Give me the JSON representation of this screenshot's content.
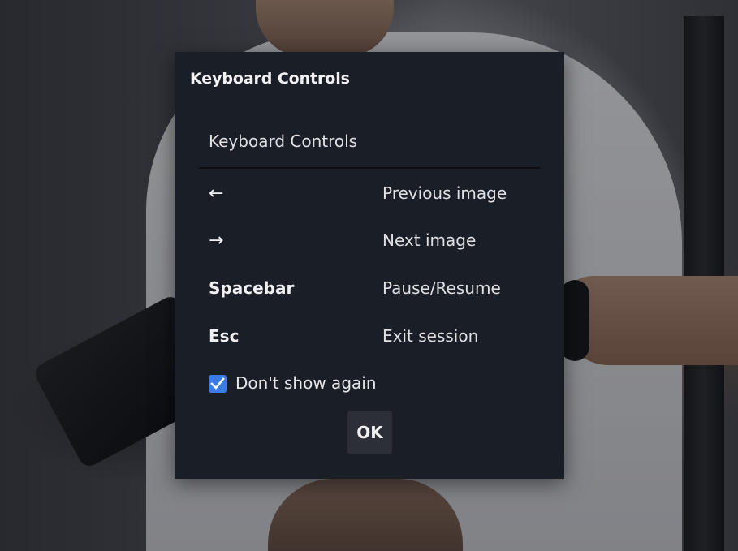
{
  "dialog": {
    "title": "Keyboard Controls",
    "section_header": "Keyboard Controls",
    "shortcuts": [
      {
        "key": "←",
        "action": "Previous image"
      },
      {
        "key": "→",
        "action": "Next image"
      },
      {
        "key": "Spacebar",
        "action": "Pause/Resume"
      },
      {
        "key": "Esc",
        "action": "Exit session"
      }
    ],
    "checkbox": {
      "label": "Don't show again",
      "checked": true
    },
    "ok_label": "OK"
  },
  "colors": {
    "dialog_bg": "#1a1e27",
    "checkbox_accent": "#3b7be6",
    "button_bg": "#2c2f37"
  },
  "icons": {
    "checkbox": "checkmark-icon"
  }
}
